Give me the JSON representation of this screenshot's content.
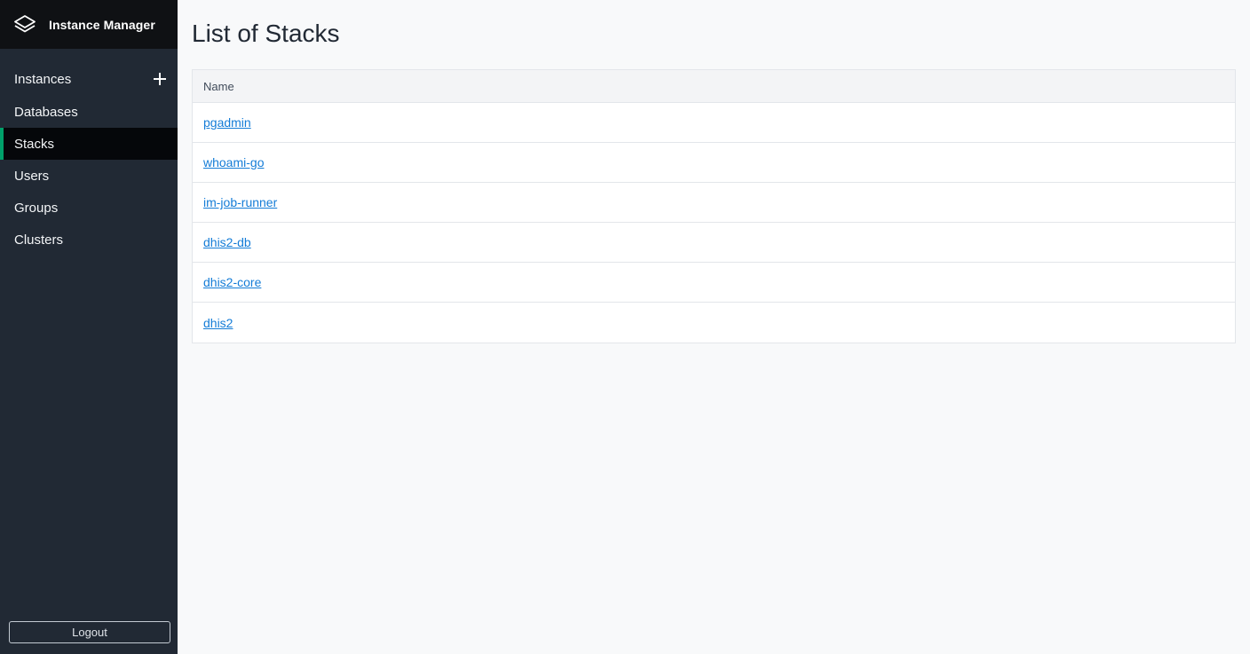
{
  "app": {
    "title": "Instance Manager",
    "logo_icon": "layers-icon"
  },
  "sidebar": {
    "items": [
      {
        "label": "Instances",
        "has_add": true,
        "add_icon": "plus-icon"
      },
      {
        "label": "Databases"
      },
      {
        "label": "Stacks",
        "active": true
      },
      {
        "label": "Users"
      },
      {
        "label": "Groups"
      },
      {
        "label": "Clusters"
      }
    ],
    "logout_label": "Logout"
  },
  "main": {
    "title": "List of Stacks",
    "table": {
      "columns": [
        "Name"
      ],
      "rows": [
        "pgadmin",
        "whoami-go",
        "im-job-runner",
        "dhis2-db",
        "dhis2-core",
        "dhis2"
      ]
    }
  },
  "colors": {
    "sidebar_bg": "#212934",
    "brand_bg": "#0f1114",
    "active_accent": "#00a06a",
    "link": "#147cd7"
  }
}
